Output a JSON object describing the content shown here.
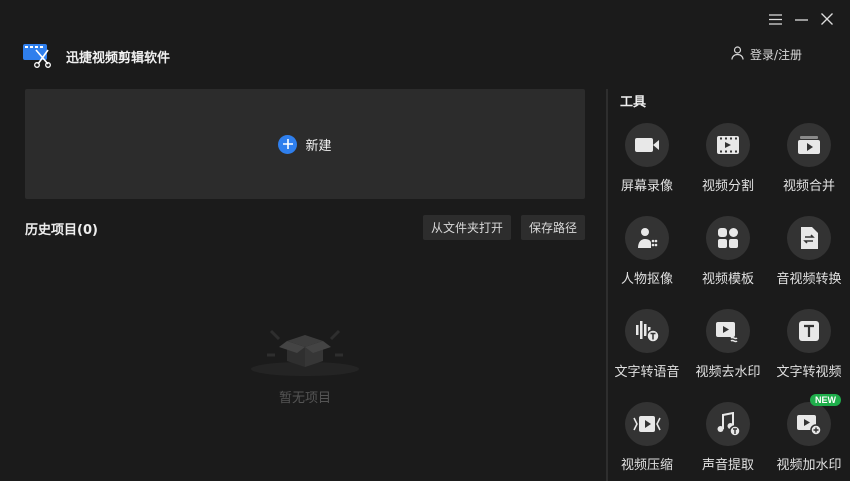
{
  "app": {
    "title": "迅捷视频剪辑软件",
    "logo": "video-scissors-logo"
  },
  "window": {
    "menu_icon": "menu-icon",
    "minimize_icon": "minimize-icon",
    "close_icon": "close-icon"
  },
  "header": {
    "login_label": "登录/注册",
    "login_icon": "user-icon"
  },
  "new_project": {
    "label": "新建",
    "icon": "plus-circle-icon"
  },
  "history": {
    "title": "历史项目(0)",
    "open_folder_label": "从文件夹打开",
    "save_path_label": "保存路径",
    "empty_text": "暂无项目",
    "empty_icon": "empty-box-icon"
  },
  "tools": {
    "title": "工具",
    "items": [
      {
        "label": "屏幕录像",
        "icon": "camera-icon"
      },
      {
        "label": "视频分割",
        "icon": "film-split-icon"
      },
      {
        "label": "视频合并",
        "icon": "video-merge-icon"
      },
      {
        "label": "人物抠像",
        "icon": "person-cutout-icon"
      },
      {
        "label": "视频模板",
        "icon": "template-icon"
      },
      {
        "label": "音视频转换",
        "icon": "convert-icon"
      },
      {
        "label": "文字转语音",
        "icon": "text-to-speech-icon"
      },
      {
        "label": "视频去水印",
        "icon": "remove-watermark-icon"
      },
      {
        "label": "文字转视频",
        "icon": "text-to-video-icon"
      },
      {
        "label": "视频压缩",
        "icon": "compress-icon"
      },
      {
        "label": "声音提取",
        "icon": "audio-extract-icon"
      },
      {
        "label": "视频加水印",
        "icon": "add-watermark-icon",
        "badge": "NEW"
      }
    ]
  },
  "colors": {
    "background": "#1b1b1b",
    "panel": "#2c2c2c",
    "accent_blue": "#2f7fed",
    "badge_green": "#1fae4b",
    "tool_circle": "#333333"
  }
}
